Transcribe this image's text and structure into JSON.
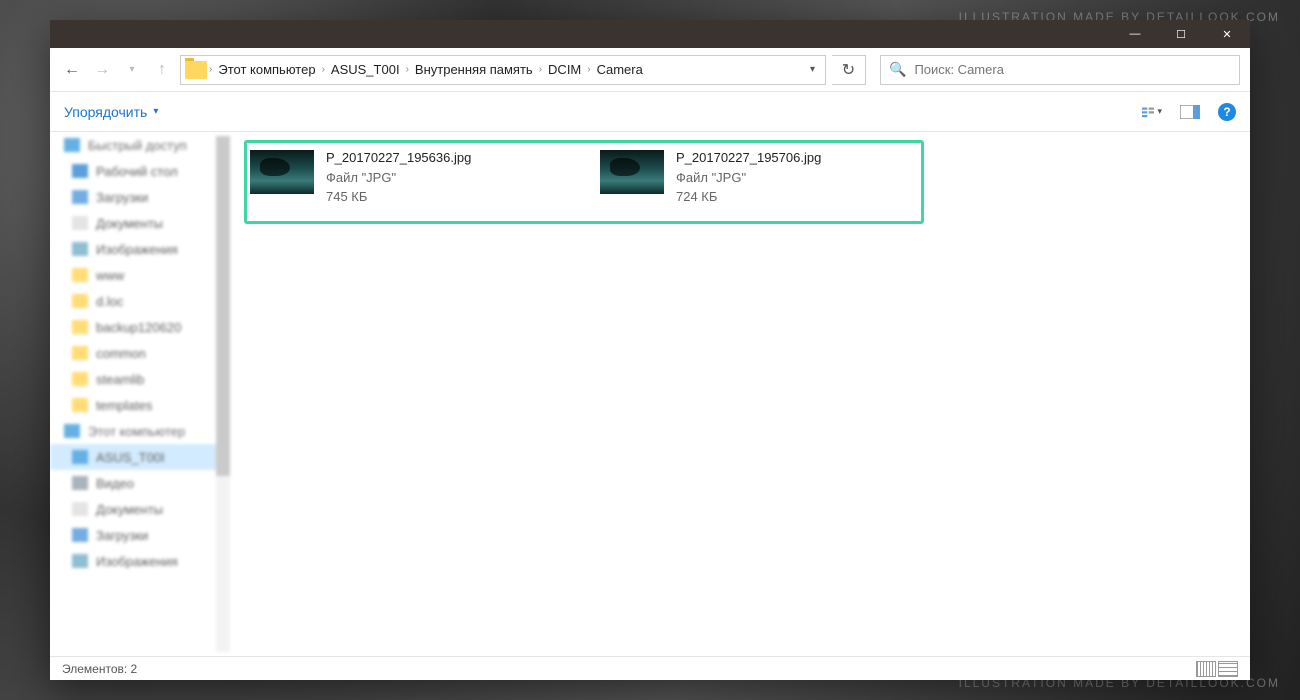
{
  "watermark": "ILLUSTRATION MADE BY DETAILLOOK.COM",
  "titlebar": {
    "minimize": "—",
    "maximize": "☐",
    "close": "✕"
  },
  "breadcrumbs": [
    "Этот компьютер",
    "ASUS_T00I",
    "Внутренняя память",
    "DCIM",
    "Camera"
  ],
  "search": {
    "placeholder": "Поиск: Camera"
  },
  "toolbar": {
    "organize": "Упорядочить"
  },
  "sidebar": {
    "items": [
      {
        "label": "Быстрый доступ",
        "icon": "ic-blue",
        "group": true
      },
      {
        "label": "Рабочий стол",
        "icon": "ic-desk"
      },
      {
        "label": "Загрузки",
        "icon": "ic-down"
      },
      {
        "label": "Документы",
        "icon": "ic-doc"
      },
      {
        "label": "Изображения",
        "icon": "ic-img"
      },
      {
        "label": "www",
        "icon": "ic-folder"
      },
      {
        "label": "d.loc",
        "icon": "ic-folder"
      },
      {
        "label": "backup120620",
        "icon": "ic-folder"
      },
      {
        "label": "common",
        "icon": "ic-folder"
      },
      {
        "label": "steamlib",
        "icon": "ic-folder"
      },
      {
        "label": "templates",
        "icon": "ic-folder"
      },
      {
        "label": "Этот компьютер",
        "icon": "ic-blue",
        "group": true
      },
      {
        "label": "ASUS_T00I",
        "icon": "ic-blue",
        "selected": true
      },
      {
        "label": "Видео",
        "icon": "ic-video"
      },
      {
        "label": "Документы",
        "icon": "ic-doc"
      },
      {
        "label": "Загрузки",
        "icon": "ic-down"
      },
      {
        "label": "Изображения",
        "icon": "ic-img"
      }
    ]
  },
  "files": [
    {
      "name": "P_20170227_195636.jpg",
      "type": "Файл \"JPG\"",
      "size": "745 КБ"
    },
    {
      "name": "P_20170227_195706.jpg",
      "type": "Файл \"JPG\"",
      "size": "724 КБ"
    }
  ],
  "status": {
    "text": "Элементов: 2"
  }
}
